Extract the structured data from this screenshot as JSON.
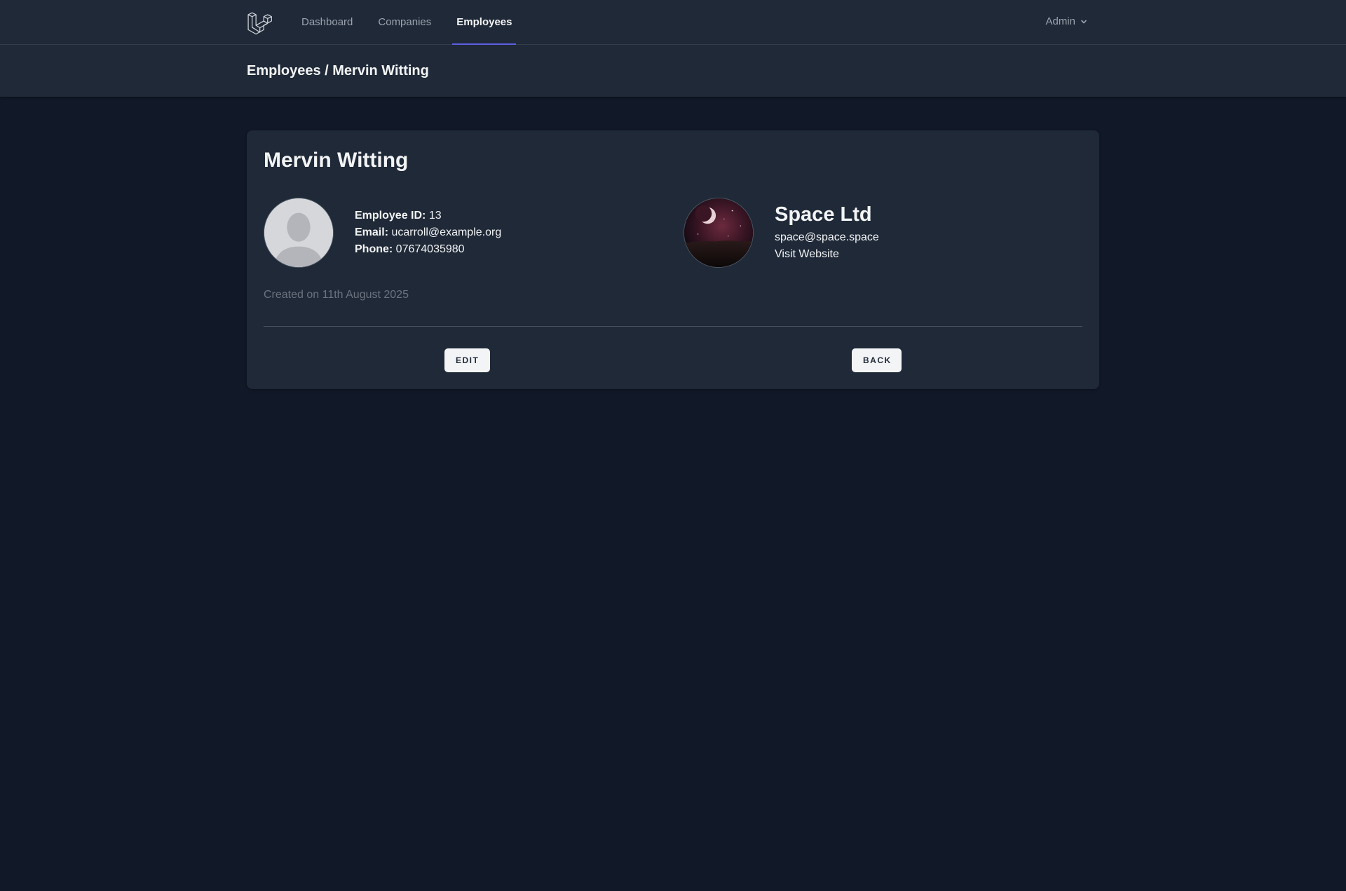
{
  "nav": {
    "items": [
      {
        "label": "Dashboard",
        "active": false
      },
      {
        "label": "Companies",
        "active": false
      },
      {
        "label": "Employees",
        "active": true
      }
    ],
    "user": "Admin",
    "accent_color": "#6366f1"
  },
  "header": {
    "breadcrumb": "Employees / Mervin Witting"
  },
  "employee": {
    "name": "Mervin Witting",
    "id_label": "Employee ID:",
    "id": "13",
    "email_label": "Email:",
    "email": "ucarroll@example.org",
    "phone_label": "Phone:",
    "phone": "07674035980",
    "created": "Created on 11th August 2025",
    "avatar_icon": "default-person-avatar"
  },
  "company": {
    "name": "Space Ltd",
    "email": "space@space.space",
    "website_label": "Visit Website",
    "logo_icon": "space-moon-logo"
  },
  "actions": {
    "edit": "EDIT",
    "back": "BACK"
  },
  "icons": {
    "logo": "laravel-logo-icon",
    "user_menu": "chevron-down-icon"
  }
}
